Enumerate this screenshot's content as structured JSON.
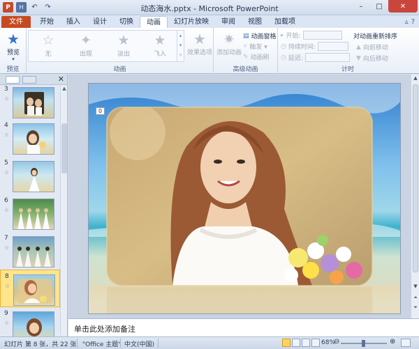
{
  "window": {
    "title": "动态海水.pptx - Microsoft PowerPoint",
    "minimize": "–",
    "maximize": "□",
    "close": "✕"
  },
  "qat": {
    "app": "P",
    "save": "H",
    "undo": "↶",
    "redo": "↷"
  },
  "tabs": [
    {
      "label": "文件",
      "key": "file"
    },
    {
      "label": "开始",
      "key": "home"
    },
    {
      "label": "插入",
      "key": "insert"
    },
    {
      "label": "设计",
      "key": "design"
    },
    {
      "label": "切换",
      "key": "transitions"
    },
    {
      "label": "动画",
      "key": "animations"
    },
    {
      "label": "幻灯片放映",
      "key": "slideshow"
    },
    {
      "label": "审阅",
      "key": "review"
    },
    {
      "label": "视图",
      "key": "view"
    },
    {
      "label": "加载项",
      "key": "addins"
    }
  ],
  "active_tab": "animations",
  "ribbon": {
    "preview": {
      "label": "预览",
      "group": "预览"
    },
    "animation_group": {
      "label": "动画",
      "items": [
        "无",
        "出现",
        "淡出",
        "飞入"
      ],
      "effect_options": "效果选项"
    },
    "advanced_group": {
      "label": "高级动画",
      "add_animation": "添加动画",
      "animation_pane": "动画窗格",
      "trigger": "触发 ▾",
      "animation_painter": "动画刷"
    },
    "timing_group": {
      "label": "计时",
      "start": "开始:",
      "duration": "持续时间:",
      "delay": "延迟:",
      "reorder_title": "对动画重新排序",
      "move_earlier": "向前移动",
      "move_later": "向后移动"
    }
  },
  "thumbnails": [
    {
      "num": "3",
      "selected": false
    },
    {
      "num": "4",
      "selected": false
    },
    {
      "num": "5",
      "selected": false
    },
    {
      "num": "6",
      "selected": false
    },
    {
      "num": "7",
      "selected": false
    },
    {
      "num": "8",
      "selected": true
    },
    {
      "num": "9",
      "selected": false
    }
  ],
  "thumbnail_star": "☆",
  "slide": {
    "anim_tag": "0"
  },
  "notes": {
    "placeholder": "单击此处添加备注"
  },
  "status": {
    "slide_info": "幻灯片 第 8 张，共 22 张",
    "theme": "\"Office 主题\"",
    "language": "中文(中国)",
    "zoom": "68%",
    "zoom_out": "⊖",
    "zoom_in": "⊕"
  },
  "colors": {
    "file_tab": "#c64a21",
    "accent": "#3a72c8",
    "selected_thumb": "#ffe48a"
  }
}
